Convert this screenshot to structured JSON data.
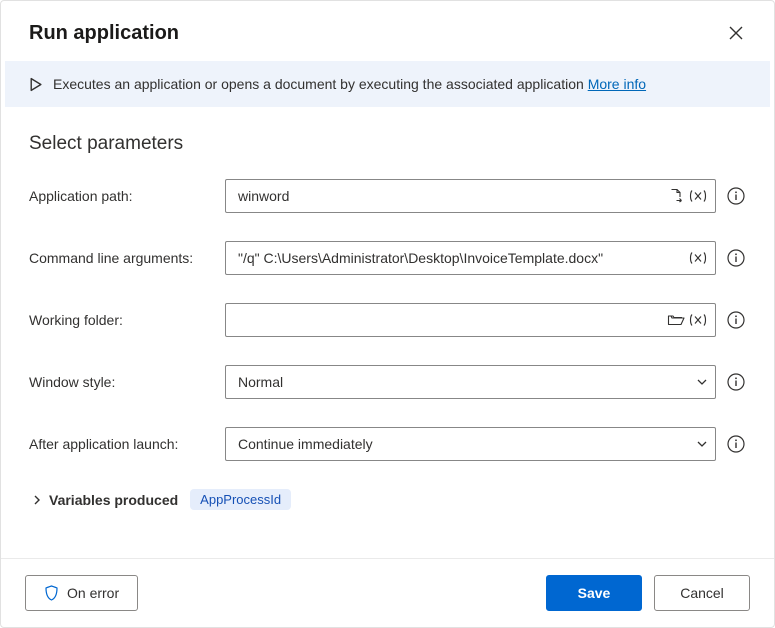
{
  "dialog": {
    "title": "Run application"
  },
  "banner": {
    "text": "Executes an application or opens a document by executing the associated application",
    "more_info": "More info"
  },
  "section": {
    "heading": "Select parameters"
  },
  "fields": {
    "app_path": {
      "label": "Application path:",
      "value": "winword"
    },
    "cmd_args": {
      "label": "Command line arguments:",
      "value": "\"/q\" C:\\Users\\Administrator\\Desktop\\InvoiceTemplate.docx\""
    },
    "working_folder": {
      "label": "Working folder:",
      "value": ""
    },
    "window_style": {
      "label": "Window style:",
      "value": "Normal"
    },
    "after_launch": {
      "label": "After application launch:",
      "value": "Continue immediately"
    }
  },
  "variables": {
    "toggle_label": "Variables produced",
    "items": [
      "AppProcessId"
    ]
  },
  "footer": {
    "on_error": "On error",
    "save": "Save",
    "cancel": "Cancel"
  }
}
